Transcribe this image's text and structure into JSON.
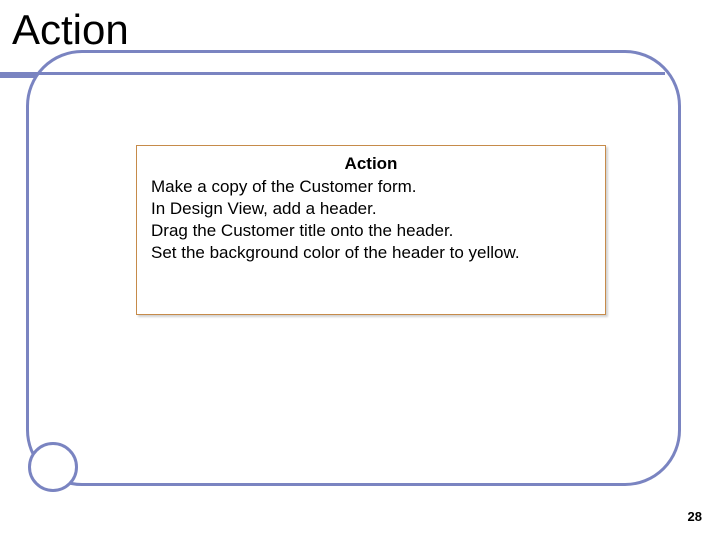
{
  "slide": {
    "title": "Action",
    "page_number": "28",
    "content": {
      "heading": "Action",
      "lines": [
        "Make a copy of the Customer form.",
        "In Design View, add a header.",
        "Drag the Customer title onto the header.",
        "Set the background color of the header to yellow."
      ]
    }
  }
}
